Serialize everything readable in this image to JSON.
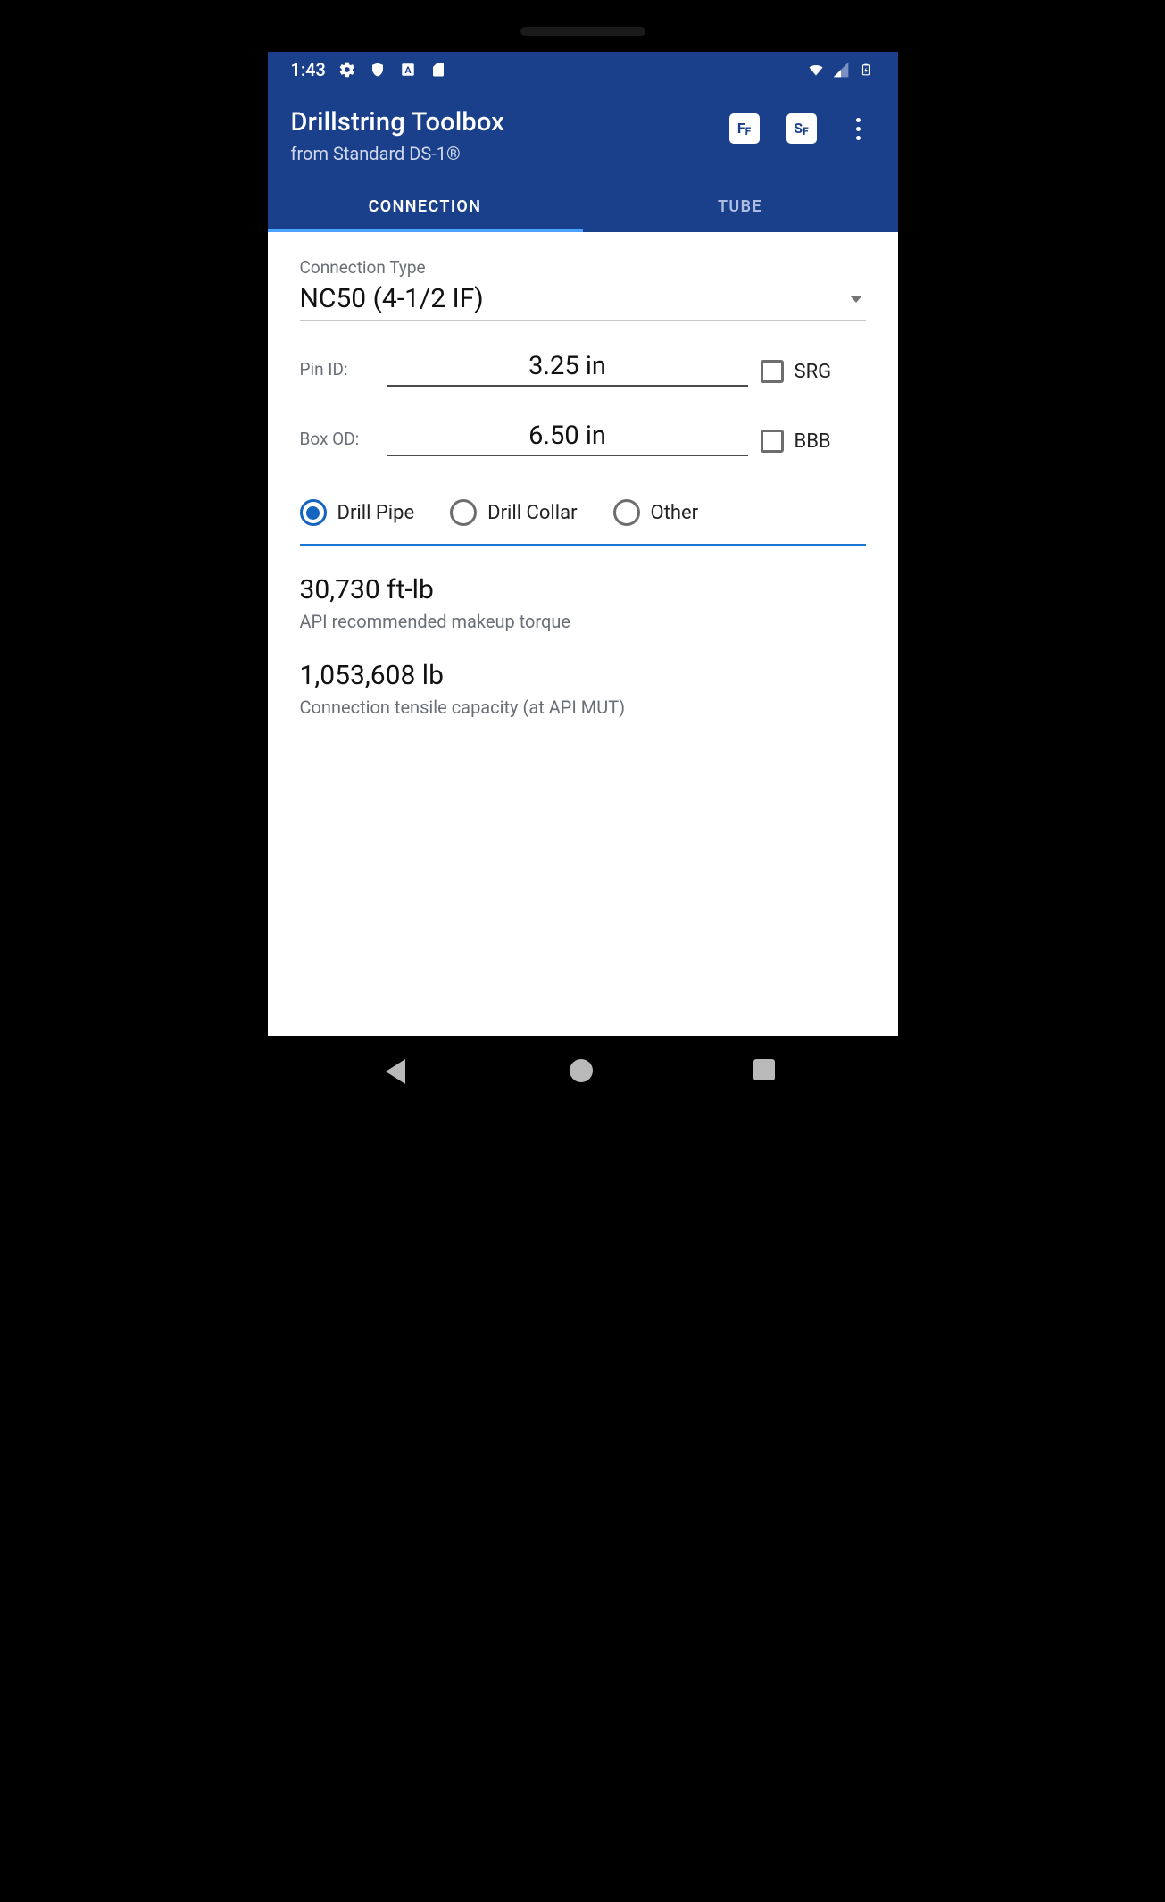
{
  "status": {
    "time": "1:43"
  },
  "app": {
    "title": "Drillstring Toolbox",
    "subtitle": "from Standard DS-1®",
    "action_ff": "FF",
    "action_sf": "SF"
  },
  "tabs": [
    {
      "label": "CONNECTION",
      "active": true
    },
    {
      "label": "TUBE",
      "active": false
    }
  ],
  "form": {
    "connection_type_label": "Connection Type",
    "connection_type_value": "NC50 (4-1/2 IF)",
    "pin_id_label": "Pin ID:",
    "pin_id_value": "3.25 in",
    "srg_label": "SRG",
    "srg_checked": false,
    "box_od_label": "Box OD:",
    "box_od_value": "6.50 in",
    "bbb_label": "BBB",
    "bbb_checked": false,
    "radios": [
      {
        "label": "Drill Pipe",
        "selected": true
      },
      {
        "label": "Drill Collar",
        "selected": false
      },
      {
        "label": "Other",
        "selected": false
      }
    ]
  },
  "results": [
    {
      "value": "30,730 ft-lb",
      "desc": "API recommended makeup torque"
    },
    {
      "value": "1,053,608 lb",
      "desc": "Connection tensile capacity (at API MUT)"
    }
  ]
}
